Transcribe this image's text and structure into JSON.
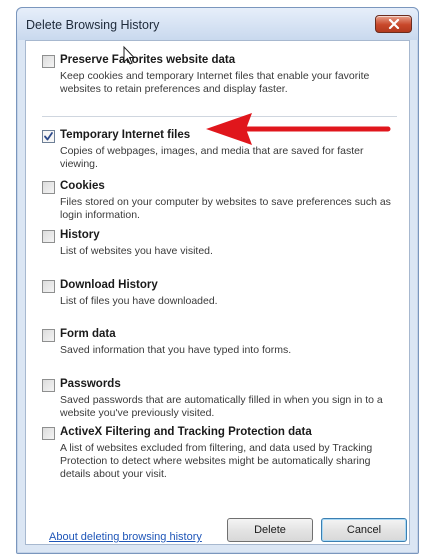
{
  "window": {
    "title": "Delete Browsing History",
    "close_label": "X"
  },
  "options": [
    {
      "title": "Preserve Favorites website data",
      "description": "Keep cookies and temporary Internet files that enable your favorite websites to retain preferences and display faster.",
      "checked": false
    },
    {
      "title": "Temporary Internet files",
      "description": "Copies of webpages, images, and media that are saved for faster viewing.",
      "checked": true
    },
    {
      "title": "Cookies",
      "description": "Files stored on your computer by websites to save preferences such as login information.",
      "checked": false
    },
    {
      "title": "History",
      "description": "List of websites you have visited.",
      "checked": false
    },
    {
      "title": "Download History",
      "description": "List of files you have downloaded.",
      "checked": false
    },
    {
      "title": "Form data",
      "description": "Saved information that you have typed into forms.",
      "checked": false
    },
    {
      "title": "Passwords",
      "description": "Saved passwords that are automatically filled in when you sign in to a website you've previously visited.",
      "checked": false
    },
    {
      "title": "ActiveX Filtering and Tracking Protection data",
      "description": "A list of websites excluded from filtering, and data used by Tracking Protection to detect where websites might be automatically sharing details about your visit.",
      "checked": false
    }
  ],
  "footer": {
    "help_link": "About deleting browsing history",
    "delete_label": "Delete",
    "cancel_label": "Cancel"
  },
  "annotation": {
    "arrow_color": "#e0161c"
  }
}
